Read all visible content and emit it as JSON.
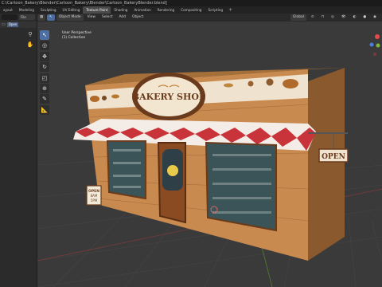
{
  "window": {
    "title": "C:\\Cartoon_Bakery\\Blender\\Cartoon_Bakery\\Blender\\Cartoon_BakeryBlender.blend]"
  },
  "workspaces": {
    "tabs": [
      "ayout",
      "Modeling",
      "Sculpting",
      "UV Editing",
      "Texture Paint",
      "Shading",
      "Animation",
      "Rendering",
      "Compositing",
      "Scripting"
    ],
    "active_index": 4,
    "add": "+"
  },
  "outliner": {
    "search_placeholder": "",
    "file_label": "File",
    "open_label": "Open"
  },
  "viewport_header": {
    "mode": "Object Mode",
    "menus": [
      "View",
      "Select",
      "Add",
      "Object"
    ],
    "transform": "Global"
  },
  "viewport": {
    "view_name": "User Perspective",
    "collection": "(1) Collection"
  },
  "scene": {
    "sign_text": "BAKERY SHOP",
    "open_sign_text": "OPEN",
    "menu_board_line1": "OPEN",
    "menu_board_line2": "8AM",
    "menu_board_line3": "5PM"
  },
  "tools": [
    "select-box",
    "cursor",
    "move",
    "rotate",
    "scale",
    "transform",
    "annotate",
    "measure"
  ],
  "colors": {
    "grid_background": "#3a3a3a",
    "wall": "#c88a4e",
    "awning_red": "#c9343a",
    "awning_white": "#f4ece6",
    "sign_oval": "#6a3a1c",
    "gizmo_x": "#e64a4a",
    "gizmo_y": "#7fba3b",
    "gizmo_z": "#4a7ee6"
  }
}
